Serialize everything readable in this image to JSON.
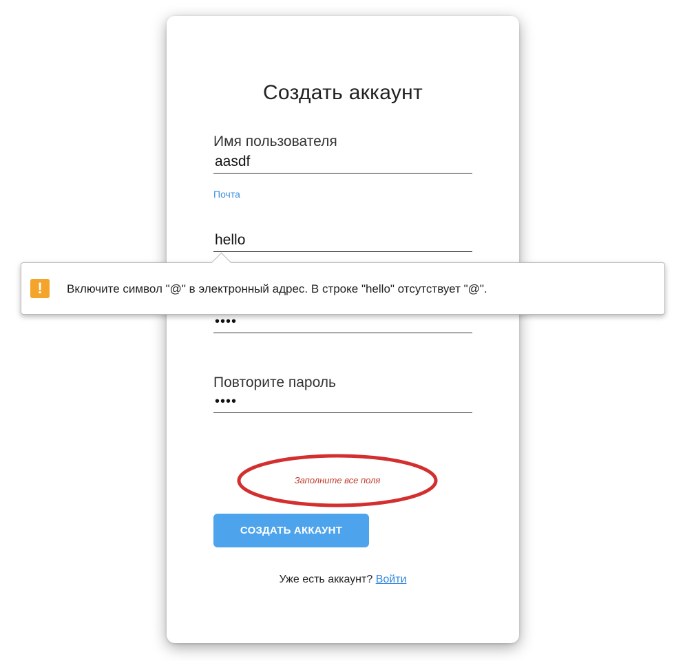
{
  "form": {
    "title": "Создать аккаунт",
    "username_label": "Имя пользователя",
    "username_value": "aasdf",
    "email_label": "Почта",
    "email_value": "hello",
    "password_value": "1234",
    "repeat_password_label": "Повторите пароль",
    "repeat_password_value": "1234",
    "error_message": "Заполните все поля",
    "submit_label": "СОЗДАТЬ АККАУНТ",
    "login_prompt": "Уже есть аккаунт?",
    "login_link": "Войти"
  },
  "tooltip": {
    "icon": "warning-icon",
    "message": "Включите символ \"@\" в электронный адрес. В строке \"hello\" отсутствует \"@\"."
  },
  "colors": {
    "accent": "#4ea4ec",
    "link": "#2f86e0",
    "error": "#c0392b",
    "annotation_ellipse": "#d32f2f",
    "warning": "#f4a42a"
  }
}
